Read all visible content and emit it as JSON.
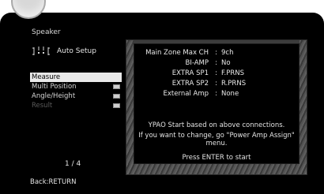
{
  "title": "Speaker",
  "auto_setup": {
    "label": "Auto Setup",
    "icon": "speaker-layout-icon"
  },
  "menu": [
    {
      "label": "Measure",
      "selected": true,
      "enabled": true,
      "icon": null
    },
    {
      "label": "Multi Position",
      "selected": false,
      "enabled": true,
      "icon": "square-icon"
    },
    {
      "label": "Angle/Height",
      "selected": false,
      "enabled": true,
      "icon": "square-icon"
    },
    {
      "label": "Result",
      "selected": false,
      "enabled": false,
      "icon": "square-icon"
    }
  ],
  "page_indicator": "1 / 4",
  "footer": {
    "back": "Back:RETURN"
  },
  "connections": [
    {
      "label": "Main Zone Max CH",
      "value": "9ch"
    },
    {
      "label": "BI-AMP",
      "value": "No"
    },
    {
      "label": "EXTRA SP1",
      "value": "F.PRNS"
    },
    {
      "label": "EXTRA SP2",
      "value": "R.PRNS"
    },
    {
      "label": "External Amp",
      "value": "None"
    }
  ],
  "message": {
    "line1": "YPAO Start based on above connections.",
    "line2": "If you want to change, go \"Power Amp Assign\"",
    "line3": "menu.",
    "prompt": "Press ENTER to start"
  },
  "colors": {
    "background": "#000000",
    "text": "#e6e6e6",
    "selection": "#e9e9e9"
  }
}
